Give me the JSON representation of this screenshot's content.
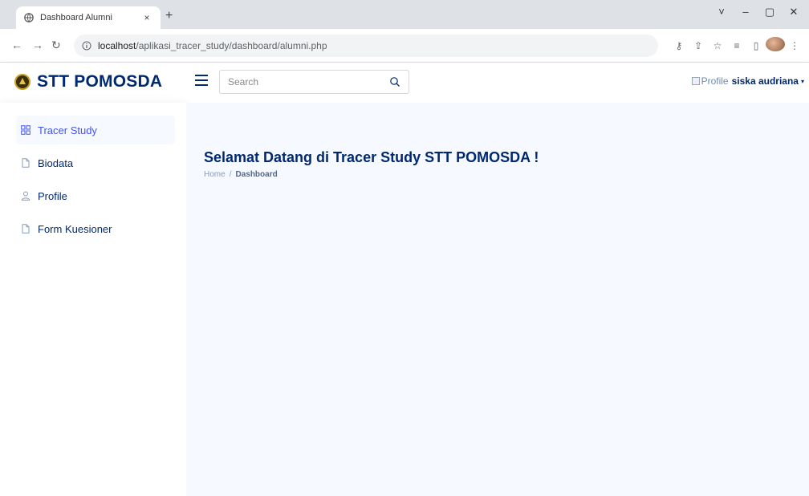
{
  "browser": {
    "tab_title": "Dashboard Alumni",
    "tab_close": "×",
    "new_tab": "+",
    "url_host": "localhost",
    "url_path": "/aplikasi_tracer_study/dashboard/alumni.php",
    "window_controls": [
      "˅",
      "–",
      "▢",
      "✕"
    ]
  },
  "header": {
    "logo_text": "STT POMOSDA",
    "search_placeholder": "Search",
    "profile_img_alt": "Profile",
    "user_name": "siska audriana",
    "caret": "▾"
  },
  "sidebar": {
    "items": [
      {
        "label": "Tracer Study",
        "icon": "grid-icon",
        "active": true
      },
      {
        "label": "Biodata",
        "icon": "file-icon",
        "active": false
      },
      {
        "label": "Profile",
        "icon": "person-icon",
        "active": false
      },
      {
        "label": "Form Kuesioner",
        "icon": "file-icon",
        "active": false
      }
    ]
  },
  "main": {
    "title": "Selamat Datang di Tracer Study STT POMOSDA !",
    "breadcrumb": {
      "home": "Home",
      "separator": "/",
      "current": "Dashboard"
    }
  },
  "colors": {
    "brand": "#012970",
    "accent": "#4154f1",
    "main_bg": "#f6f9ff",
    "muted": "#899bbd"
  }
}
